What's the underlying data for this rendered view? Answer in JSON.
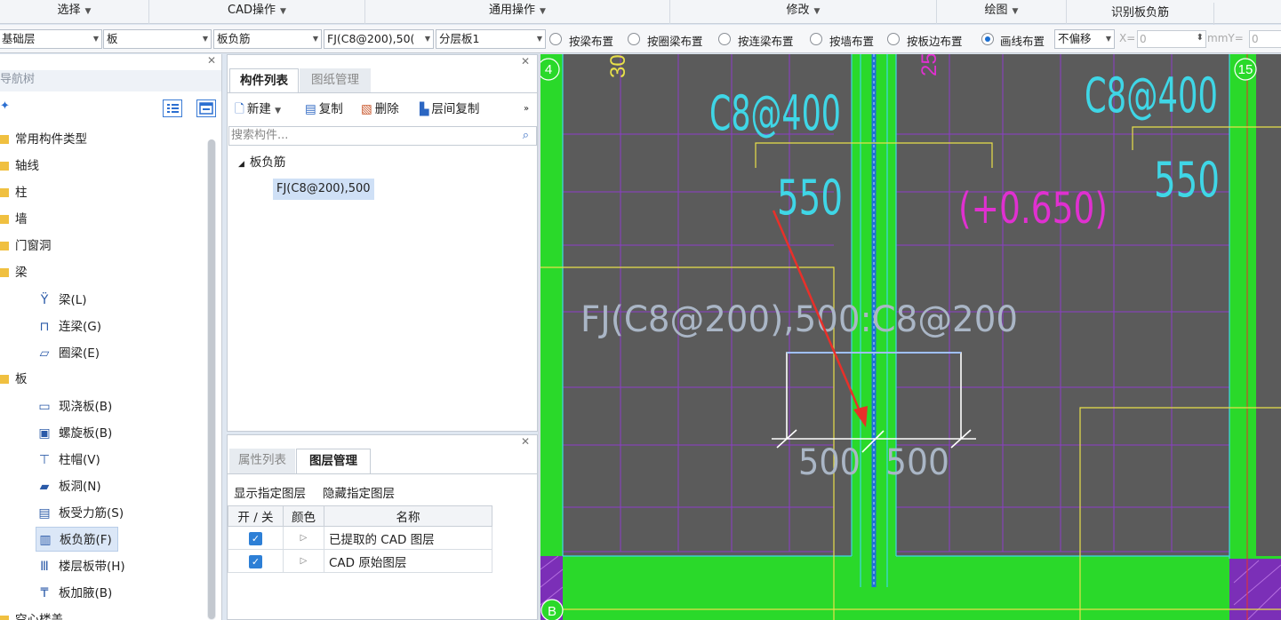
{
  "ribbon": {
    "groups": [
      {
        "label": "选择",
        "has_dropdown": true
      },
      {
        "label": "CAD操作",
        "has_dropdown": true
      },
      {
        "label": "通用操作",
        "has_dropdown": true
      },
      {
        "label": "修改",
        "has_dropdown": true
      },
      {
        "label": "绘图",
        "has_dropdown": true
      },
      {
        "label": "识别板负筋",
        "has_dropdown": false
      }
    ]
  },
  "toolbar": {
    "floor_select": "基础层",
    "category_select": "板",
    "type_select": "板负筋",
    "component_select": "FJ(C8@200),50(",
    "layer_select": "分层板1",
    "placement_modes": [
      {
        "label": "按梁布置",
        "selected": false
      },
      {
        "label": "按圈梁布置",
        "selected": false
      },
      {
        "label": "按连梁布置",
        "selected": false
      },
      {
        "label": "按墙布置",
        "selected": false
      },
      {
        "label": "按板边布置",
        "selected": false
      },
      {
        "label": "画线布置",
        "selected": true
      }
    ],
    "offset_select": "不偏移",
    "x_label": "X=",
    "x_value": "0",
    "y_label": "mmY=",
    "y_value": "0"
  },
  "nav_tree": {
    "title": "导航树",
    "items": [
      {
        "label": "常用构件类型"
      },
      {
        "label": "轴线"
      },
      {
        "label": "柱"
      },
      {
        "label": "墙"
      },
      {
        "label": "门窗洞"
      },
      {
        "label": "梁"
      }
    ],
    "beam_children": [
      {
        "label": "梁(L)",
        "icon": "beam-icon"
      },
      {
        "label": "连梁(G)",
        "icon": "coupling-beam-icon"
      },
      {
        "label": "圈梁(E)",
        "icon": "ring-beam-icon"
      }
    ],
    "slab_label": "板",
    "slab_children": [
      {
        "label": "现浇板(B)",
        "icon": "cast-slab-icon",
        "selected": false
      },
      {
        "label": "螺旋板(B)",
        "icon": "spiral-slab-icon",
        "selected": false
      },
      {
        "label": "柱帽(V)",
        "icon": "column-cap-icon",
        "selected": false
      },
      {
        "label": "板洞(N)",
        "icon": "slab-hole-icon",
        "selected": false
      },
      {
        "label": "板受力筋(S)",
        "icon": "slab-rebar-icon",
        "selected": false
      },
      {
        "label": "板负筋(F)",
        "icon": "slab-negative-rebar-icon",
        "selected": true
      },
      {
        "label": "楼层板带(H)",
        "icon": "floor-strip-icon",
        "selected": false
      },
      {
        "label": "板加腋(B)",
        "icon": "slab-haunch-icon",
        "selected": false
      }
    ],
    "last_item": "空心楼盖"
  },
  "component_panel": {
    "tabs": [
      "构件列表",
      "图纸管理"
    ],
    "actions": {
      "new": "新建",
      "copy": "复制",
      "delete": "删除",
      "floor_copy": "层间复制"
    },
    "search_placeholder": "搜索构件...",
    "tree_root": "板负筋",
    "tree_leaf": "FJ(C8@200),500"
  },
  "layer_panel": {
    "tabs": [
      "属性列表",
      "图层管理"
    ],
    "show_layer": "显示指定图层",
    "hide_layer": "隐藏指定图层",
    "columns": [
      "开 / 关",
      "颜色",
      "名称"
    ],
    "rows": [
      {
        "name": "已提取的 CAD 图层",
        "checked": true
      },
      {
        "name": "CAD 原始图层",
        "checked": true
      }
    ]
  },
  "cad": {
    "axis_labels": [
      "4",
      "15",
      "B"
    ],
    "rebar_top_left": "C8@400",
    "rebar_top_right": "C8@400",
    "dim_left": "550",
    "dim_right": "550",
    "elevation": "(+0.650)",
    "component_text": "FJ(C8@200),500:C8@200",
    "dim_bottom_left": "500",
    "dim_bottom_right": "500",
    "colors": {
      "background": "#5b5b5b",
      "green": "#2ad92a",
      "cyan": "#3fd6e6",
      "magenta": "#e030d0",
      "yellow": "#e8e04a",
      "purple": "#8c3cc8",
      "red_arrow": "#e8302a"
    }
  }
}
